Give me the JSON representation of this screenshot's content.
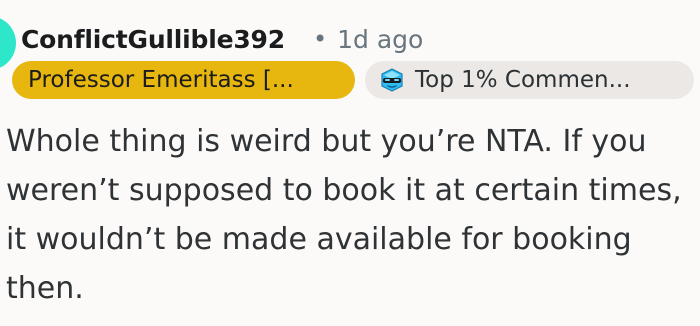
{
  "comment": {
    "username": "ConflictGullible392",
    "separator": "•",
    "timestamp": "1d ago",
    "flair_primary": "Professor Emeritass [...",
    "flair_secondary": "Top 1% Commen...",
    "body": "Whole thing is weird but you’re NTA. If you weren’t supposed to book it at certain times, it wouldn’t be made available for booking then."
  },
  "icons": {
    "avatar": "avatar-circle",
    "badge": "top-commenter-badge-icon"
  },
  "colors": {
    "avatar": "#2ee6c9",
    "primary_flair_bg": "#e7b60f",
    "secondary_flair_bg": "#ebe8e6"
  }
}
